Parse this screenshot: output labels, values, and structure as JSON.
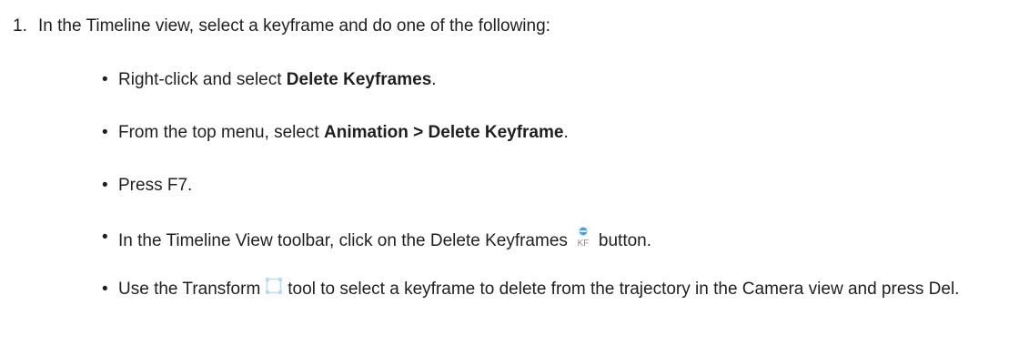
{
  "step": {
    "number": "1.",
    "text": "In the Timeline view, select a keyframe and do one of the following:"
  },
  "bullets": [
    {
      "pre": "Right-click and select ",
      "bold": "Delete Keyframes",
      "post": "."
    },
    {
      "pre": "From the top menu, select ",
      "bold": "Animation > Delete Keyframe",
      "post": "."
    },
    {
      "text": "Press F7."
    },
    {
      "pre": "In the Timeline View toolbar, click on the Delete Keyframes",
      "icon": "delete-keyframes-icon",
      "post": "button."
    },
    {
      "pre": "Use the Transform",
      "icon": "transform-tool-icon",
      "post": "tool to select a keyframe to delete from the trajectory in the Camera view and press Del."
    }
  ],
  "icons": {
    "delete_keyframes_label": "KF",
    "accent": "#4aa3df",
    "icon_gray": "#8a8a8a",
    "transform_color": "#b9ddf0"
  }
}
